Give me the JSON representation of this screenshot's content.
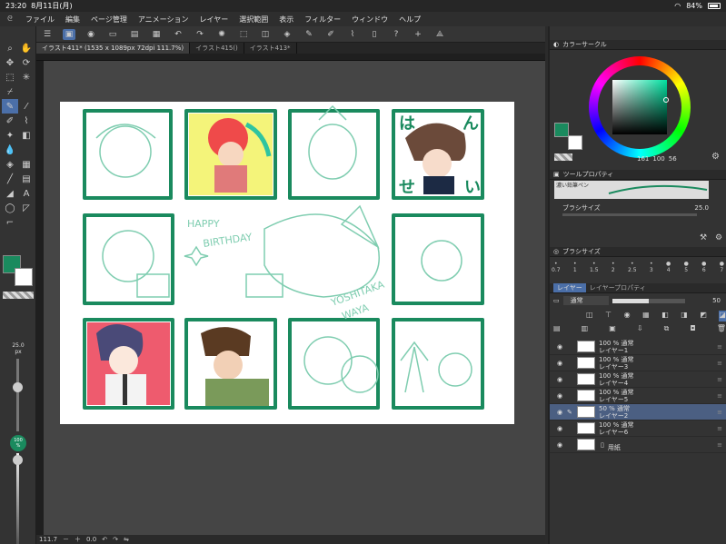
{
  "status": {
    "time": "23:20",
    "date": "8月11日(月)",
    "battery": "84%"
  },
  "menu": [
    "ファイル",
    "編集",
    "ページ管理",
    "アニメーション",
    "レイヤー",
    "選択範囲",
    "表示",
    "フィルター",
    "ウィンドウ",
    "ヘルプ"
  ],
  "tabs": [
    "イラスト411* (1535 x 1089px 72dpi 111.7%)",
    "イラスト415()",
    "イラスト413*"
  ],
  "bottom": {
    "zoom": "111.7",
    "angle": "0.0"
  },
  "toolbox": {
    "brush_size": "25.0",
    "brush_unit": "px",
    "opacity": "100",
    "opacity_unit": "%"
  },
  "colors": {
    "main": "#1a8a5e",
    "sub": "#ffffff"
  },
  "color_panel": {
    "title": "カラーサークル",
    "hsv": [
      "161",
      "100",
      "56"
    ]
  },
  "tool_property": {
    "title": "ツールプロパティ",
    "tool_name": "濃い鉛筆ペン",
    "brush_size_label": "ブラシサイズ",
    "brush_size_value": "25.0"
  },
  "brush_size_panel": {
    "title": "ブラシサイズ",
    "sizes": [
      "0.7",
      "1",
      "1.5",
      "2",
      "2.5",
      "3",
      "4",
      "5",
      "6",
      "7"
    ]
  },
  "layer_panel": {
    "tab_layer": "レイヤー",
    "tab_prop": "レイヤープロパティ",
    "blend": "通常",
    "opacity": "50"
  },
  "layers": [
    {
      "pct": "100 %",
      "mode": "通常",
      "name": "レイヤー1",
      "selected": false
    },
    {
      "pct": "100 %",
      "mode": "通常",
      "name": "レイヤー3",
      "selected": false
    },
    {
      "pct": "100 %",
      "mode": "通常",
      "name": "レイヤー4",
      "selected": false
    },
    {
      "pct": "100 %",
      "mode": "通常",
      "name": "レイヤー5",
      "selected": false
    },
    {
      "pct": "50 %",
      "mode": "通常",
      "name": "レイヤー2",
      "selected": true
    },
    {
      "pct": "100 %",
      "mode": "通常",
      "name": "レイヤー6",
      "selected": false
    },
    {
      "pct": "",
      "mode": "",
      "name": "用紙",
      "selected": false
    }
  ],
  "artwork": {
    "text_happy": "HAPPY",
    "text_birthday": "BIRTHDAY",
    "text_name1": "YOSHITAKA",
    "text_name2": "WAYA",
    "hira": [
      "は",
      "ん",
      "せ",
      "い"
    ]
  }
}
